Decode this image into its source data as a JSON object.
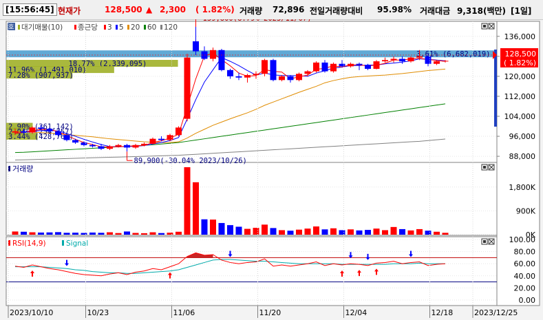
{
  "quote": {
    "time": "[15:56:45]",
    "price_label": "현재가",
    "price": "128,500",
    "change_arrow": "▲",
    "change": "2,300",
    "change_pct": "( 1.82%)",
    "volume_label": "거래량",
    "volume": "72,896",
    "prev_volume_ratio_label": "전일거래량대비",
    "prev_volume_ratio": "95.98%",
    "trade_value_label": "거래대금",
    "trade_value": "9,318(백만)",
    "period": "[1일]"
  },
  "colors": {
    "up": "#ff0000",
    "down": "#0000ff",
    "ma3": "#ff0000",
    "ma5": "#0000ff",
    "ma20": "#e08c00",
    "ma60": "#008000",
    "ma120": "#808080",
    "signal": "#00aaaa",
    "rsi": "#ff0000",
    "vp_bar": "#a0b028",
    "vp_max": "#4fa0d0"
  },
  "chart_data": [
    {
      "type": "candlestick",
      "panel": "price",
      "legend": {
        "tag": "호",
        "items": [
          {
            "label": "대기매물(10)",
            "color": "#a0b028"
          },
          {
            "label": "종근당",
            "color": "#ff0000"
          },
          {
            "label": "3",
            "color": "#ff0000"
          },
          {
            "label": "5",
            "color": "#0000ff"
          },
          {
            "label": "20",
            "color": "#e08c00"
          },
          {
            "label": "60",
            "color": "#008000"
          },
          {
            "label": "120",
            "color": "#808080"
          }
        ]
      },
      "y_ticks": [
        "136,000",
        "128,000",
        "120,000",
        "112,000",
        "104,000",
        "96,000",
        "88,000"
      ],
      "y_tick_values": [
        136000,
        128000,
        120000,
        112000,
        104000,
        96000,
        88000
      ],
      "ylim": [
        85000,
        142000
      ],
      "current_price": {
        "text": "128,500",
        "pct": "( 1.82%)",
        "value": 128500
      },
      "annotations": [
        {
          "text": "139,800(8.79% 2023/11/07)",
          "value": 139800,
          "index": 21
        },
        {
          "text": "89,900(-30.04% 2023/10/26)",
          "value": 89900,
          "index": 13
        }
      ],
      "ohlc": [
        [
          97500,
          99000,
          96500,
          98000
        ],
        [
          98000,
          99000,
          97000,
          97500
        ],
        [
          97500,
          100000,
          97000,
          99500
        ],
        [
          99500,
          100500,
          98500,
          99000
        ],
        [
          99000,
          99500,
          97500,
          98000
        ],
        [
          98000,
          98500,
          96000,
          96500
        ],
        [
          96500,
          97000,
          94000,
          94500
        ],
        [
          94500,
          95000,
          93000,
          93500
        ],
        [
          93500,
          94000,
          92000,
          92500
        ],
        [
          92500,
          93000,
          91500,
          92000
        ],
        [
          92000,
          93000,
          90500,
          91000
        ],
        [
          91000,
          92500,
          90500,
          92000
        ],
        [
          92000,
          93000,
          91500,
          92500
        ],
        [
          92500,
          93000,
          89900,
          91500
        ],
        [
          91500,
          93000,
          91000,
          92500
        ],
        [
          92500,
          93500,
          92000,
          93000
        ],
        [
          93000,
          95500,
          92800,
          95000
        ],
        [
          95000,
          96000,
          94000,
          94500
        ],
        [
          94500,
          97000,
          94000,
          96500
        ],
        [
          96500,
          100000,
          96000,
          99500
        ],
        [
          103000,
          129000,
          102000,
          127500
        ],
        [
          134000,
          139800,
          128500,
          130000
        ],
        [
          130000,
          132000,
          126500,
          127000
        ],
        [
          127000,
          131500,
          126000,
          130500
        ],
        [
          130500,
          131000,
          122000,
          122500
        ],
        [
          122500,
          123000,
          119000,
          120000
        ],
        [
          120000,
          121500,
          118500,
          119500
        ],
        [
          119500,
          121000,
          117500,
          120500
        ],
        [
          120500,
          122000,
          119000,
          121000
        ],
        [
          121000,
          127000,
          120000,
          126500
        ],
        [
          126500,
          127000,
          118000,
          118500
        ],
        [
          118500,
          120500,
          118000,
          120000
        ],
        [
          120000,
          120500,
          117500,
          118500
        ],
        [
          118500,
          121500,
          118000,
          121000
        ],
        [
          121000,
          122500,
          120000,
          122000
        ],
        [
          122000,
          126000,
          121500,
          125500
        ],
        [
          125500,
          126500,
          121500,
          122000
        ],
        [
          122000,
          125500,
          121500,
          125000
        ],
        [
          125000,
          126500,
          123500,
          124000
        ],
        [
          124000,
          125500,
          123500,
          125000
        ],
        [
          125000,
          125500,
          122500,
          124500
        ],
        [
          124500,
          125000,
          122500,
          123000
        ],
        [
          123000,
          126500,
          122800,
          126000
        ],
        [
          126000,
          127500,
          125500,
          126500
        ],
        [
          126500,
          128000,
          125500,
          127000
        ],
        [
          127000,
          128000,
          125000,
          126000
        ],
        [
          126000,
          128000,
          125500,
          127500
        ],
        [
          127500,
          130500,
          126500,
          128000
        ],
        [
          128000,
          129000,
          124000,
          125000
        ],
        [
          125000,
          126500,
          124500,
          126000
        ],
        [
          126000,
          126500,
          125500,
          126200
        ]
      ],
      "ma3": [
        97200,
        97600,
        98300,
        98700,
        98800,
        97800,
        96300,
        94800,
        93500,
        92700,
        91800,
        91700,
        91800,
        92000,
        92200,
        92300,
        93500,
        94200,
        95300,
        96800,
        107800,
        119000,
        128200,
        129200,
        126700,
        124200,
        121300,
        120000,
        120300,
        122700,
        122000,
        121700,
        119000,
        119800,
        120500,
        122800,
        123200,
        124200,
        123700,
        124700,
        124500,
        124200,
        124500,
        125200,
        126500,
        126500,
        127000,
        127200,
        126800,
        126300,
        126000
      ],
      "ma5": [
        97200,
        97500,
        98000,
        98300,
        98400,
        98100,
        97100,
        96000,
        94800,
        93700,
        92700,
        91900,
        91800,
        91900,
        92000,
        92300,
        92900,
        93500,
        94300,
        95500,
        102900,
        110700,
        117700,
        122600,
        127500,
        126000,
        124300,
        122300,
        120500,
        121300,
        120600,
        120300,
        120300,
        120200,
        120000,
        121300,
        122200,
        123300,
        123700,
        124300,
        124300,
        124500,
        124500,
        125000,
        125300,
        125700,
        126200,
        127000,
        126800,
        126500,
        126200
      ],
      "ma20": [
        98000,
        97800,
        97700,
        97500,
        97300,
        97000,
        96700,
        96400,
        96100,
        95800,
        95400,
        95000,
        94700,
        94400,
        94100,
        93800,
        93600,
        93500,
        93500,
        93800,
        95300,
        97200,
        98800,
        100400,
        101700,
        103000,
        104200,
        105400,
        106800,
        108400,
        109700,
        111000,
        112300,
        113600,
        114800,
        116000,
        117400,
        118300,
        119000,
        119600,
        119900,
        120100,
        120300,
        120500,
        120800,
        121100,
        121500,
        121900,
        122300,
        122600,
        122900
      ],
      "ma60": [
        89500,
        89600,
        89800,
        90000,
        90200,
        90400,
        90600,
        90800,
        91000,
        91200,
        91400,
        91600,
        91800,
        92000,
        92200,
        92400,
        92600,
        92900,
        93200,
        93500,
        94000,
        94500,
        95000,
        95500,
        96000,
        96500,
        97000,
        97500,
        98000,
        98500,
        99000,
        99500,
        100000,
        100500,
        101000,
        101500,
        102000,
        102500,
        103000,
        103500,
        104000,
        104500,
        105000,
        105500,
        106000,
        106500,
        107000,
        107500,
        108000,
        108500,
        109000
      ],
      "ma120": [
        86500,
        86600,
        86700,
        86800,
        86900,
        87000,
        87100,
        87200,
        87300,
        87400,
        87500,
        87600,
        87700,
        87800,
        87900,
        88000,
        88100,
        88200,
        88300,
        88400,
        88600,
        88800,
        89000,
        89200,
        89400,
        89600,
        89800,
        90000,
        90200,
        90400,
        90600,
        90800,
        91000,
        91200,
        91400,
        91600,
        91800,
        92000,
        92200,
        92400,
        92600,
        92800,
        93000,
        93200,
        93400,
        93600,
        93800,
        94000,
        94300,
        94600,
        94900
      ],
      "volume_profile": [
        {
          "price": 129000,
          "text": "3.61% (6,682,019)",
          "ratio": 1.0
        },
        {
          "price": 125200,
          "text": "18.77% (2,339,095)",
          "ratio": 0.35
        },
        {
          "price": 122700,
          "text": "11.96% (1,491,010)",
          "ratio": 0.22
        },
        {
          "price": 120500,
          "text": "7.28% (907,937)",
          "ratio": 0.135
        },
        {
          "price": 100000,
          "text": "2.90% (361,142)",
          "ratio": 0.054
        },
        {
          "price": 98000,
          "text": "2.04% (254,357)",
          "ratio": 0.038
        },
        {
          "price": 96000,
          "text": "3.44% (428,769)",
          "ratio": 0.064
        }
      ]
    },
    {
      "type": "bar",
      "panel": "volume",
      "title": "거래량",
      "y_ticks": [
        "1,800K",
        "900K",
        "0K"
      ],
      "y_tick_values": [
        1800000,
        900000,
        0
      ],
      "ylim": [
        0,
        2600000
      ],
      "values": [
        120000,
        110000,
        90000,
        80000,
        85000,
        95000,
        70000,
        75000,
        65000,
        80000,
        70000,
        90000,
        60000,
        120000,
        65000,
        55000,
        90000,
        60000,
        75000,
        110000,
        2550000,
        1980000,
        580000,
        570000,
        440000,
        360000,
        300000,
        220000,
        260000,
        380000,
        250000,
        170000,
        150000,
        190000,
        230000,
        310000,
        200000,
        240000,
        170000,
        200000,
        160000,
        180000,
        230000,
        170000,
        290000,
        210000,
        160000,
        210000,
        150000,
        110000,
        70000
      ],
      "up": [
        1,
        0,
        1,
        0,
        0,
        0,
        0,
        0,
        0,
        0,
        0,
        1,
        1,
        0,
        1,
        1,
        1,
        0,
        1,
        1,
        1,
        1,
        0,
        1,
        0,
        0,
        0,
        1,
        1,
        1,
        0,
        1,
        0,
        1,
        1,
        1,
        0,
        1,
        0,
        1,
        0,
        0,
        1,
        1,
        1,
        0,
        1,
        1,
        0,
        1,
        1
      ]
    },
    {
      "type": "line",
      "panel": "rsi",
      "legend": [
        {
          "label": "RSI(14,9)",
          "color": "#ff0000"
        },
        {
          "label": "Signal",
          "color": "#00aaaa"
        }
      ],
      "y_ticks": [
        "100.00",
        "80.00",
        "60.00",
        "40.00",
        "20.00",
        "0.00"
      ],
      "y_tick_values": [
        100,
        80,
        60,
        40,
        20,
        0
      ],
      "ylim": [
        0,
        100
      ],
      "reference_lines": [
        70,
        30
      ],
      "rsi": [
        56,
        54,
        58,
        55,
        52,
        50,
        47,
        44,
        42,
        41,
        40,
        43,
        45,
        42,
        46,
        48,
        52,
        50,
        55,
        60,
        72,
        78,
        74,
        75,
        66,
        62,
        60,
        62,
        63,
        68,
        56,
        58,
        56,
        58,
        60,
        63,
        57,
        60,
        58,
        60,
        59,
        57,
        61,
        62,
        64,
        60,
        62,
        63,
        57,
        59,
        60
      ],
      "signal": [
        55,
        55,
        55,
        55,
        54,
        53,
        52,
        50,
        49,
        47,
        46,
        45,
        45,
        44,
        44,
        45,
        46,
        47,
        48,
        50,
        54,
        58,
        62,
        66,
        67,
        67,
        66,
        65,
        64,
        64,
        63,
        62,
        61,
        60,
        60,
        60,
        60,
        60,
        59,
        59,
        59,
        59,
        59,
        59,
        60,
        60,
        60,
        61,
        60,
        60,
        60
      ],
      "arrows": [
        {
          "index": 2,
          "dir": "up"
        },
        {
          "index": 6,
          "dir": "down"
        },
        {
          "index": 18,
          "dir": "up"
        },
        {
          "index": 25,
          "dir": "down"
        },
        {
          "index": 38,
          "dir": "up"
        },
        {
          "index": 39,
          "dir": "down"
        },
        {
          "index": 40,
          "dir": "up"
        },
        {
          "index": 41,
          "dir": "down"
        },
        {
          "index": 42,
          "dir": "up"
        },
        {
          "index": 46,
          "dir": "down"
        }
      ]
    }
  ],
  "x_axis": {
    "labels": [
      {
        "text": "2023/10/10",
        "index": 0
      },
      {
        "text": "10/23",
        "index": 9
      },
      {
        "text": "11/06",
        "index": 19
      },
      {
        "text": "11/20",
        "index": 29
      },
      {
        "text": "12/04",
        "index": 39
      },
      {
        "text": "12/18",
        "index": 49
      },
      {
        "text": "2023/12/25",
        "index": 54
      }
    ]
  }
}
